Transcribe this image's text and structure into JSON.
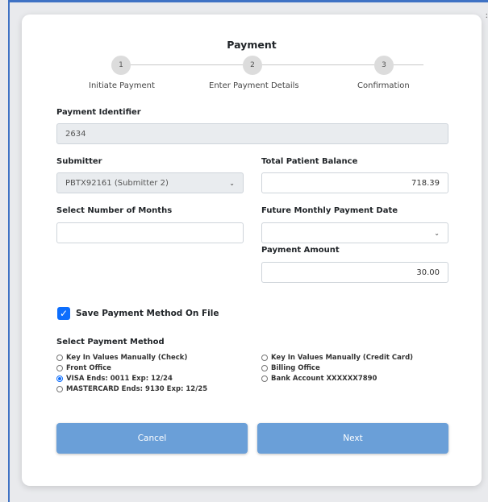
{
  "modal": {
    "title": "Payment",
    "corner_mark": ":"
  },
  "stepper": {
    "steps": [
      {
        "number": "1",
        "label": "Initiate Payment"
      },
      {
        "number": "2",
        "label": "Enter Payment Details"
      },
      {
        "number": "3",
        "label": "Confirmation"
      }
    ]
  },
  "form": {
    "payment_identifier": {
      "label": "Payment Identifier",
      "value": "2634"
    },
    "submitter": {
      "label": "Submitter",
      "value": "PBTX92161 (Submitter 2)"
    },
    "total_patient_balance": {
      "label": "Total Patient Balance",
      "value": "718.39"
    },
    "number_of_months": {
      "label": "Select Number of Months",
      "value": ""
    },
    "future_monthly_payment_date": {
      "label": "Future Monthly Payment Date",
      "value": ""
    },
    "payment_amount": {
      "label": "Payment Amount",
      "value": "30.00"
    },
    "save_payment_method": {
      "label": "Save Payment Method On File",
      "checked": true,
      "check_glyph": "✓"
    },
    "payment_method": {
      "label": "Select Payment Method",
      "options_left": [
        {
          "label": "Key In Values Manually (Check)",
          "selected": false
        },
        {
          "label": "Front Office",
          "selected": false
        },
        {
          "label": "VISA Ends: 0011 Exp: 12/24",
          "selected": true
        },
        {
          "label": "MASTERCARD Ends: 9130 Exp: 12/25",
          "selected": false
        }
      ],
      "options_right": [
        {
          "label": "Key In Values Manually (Credit Card)",
          "selected": false
        },
        {
          "label": "Billing Office",
          "selected": false
        },
        {
          "label": "Bank Account XXXXXX7890",
          "selected": false
        }
      ]
    }
  },
  "buttons": {
    "cancel": "Cancel",
    "next": "Next"
  },
  "colors": {
    "accent": "#0d6efd",
    "button": "#6a9fd8",
    "frame": "#3f72c4"
  },
  "icons": {
    "chevron": "⌄"
  }
}
